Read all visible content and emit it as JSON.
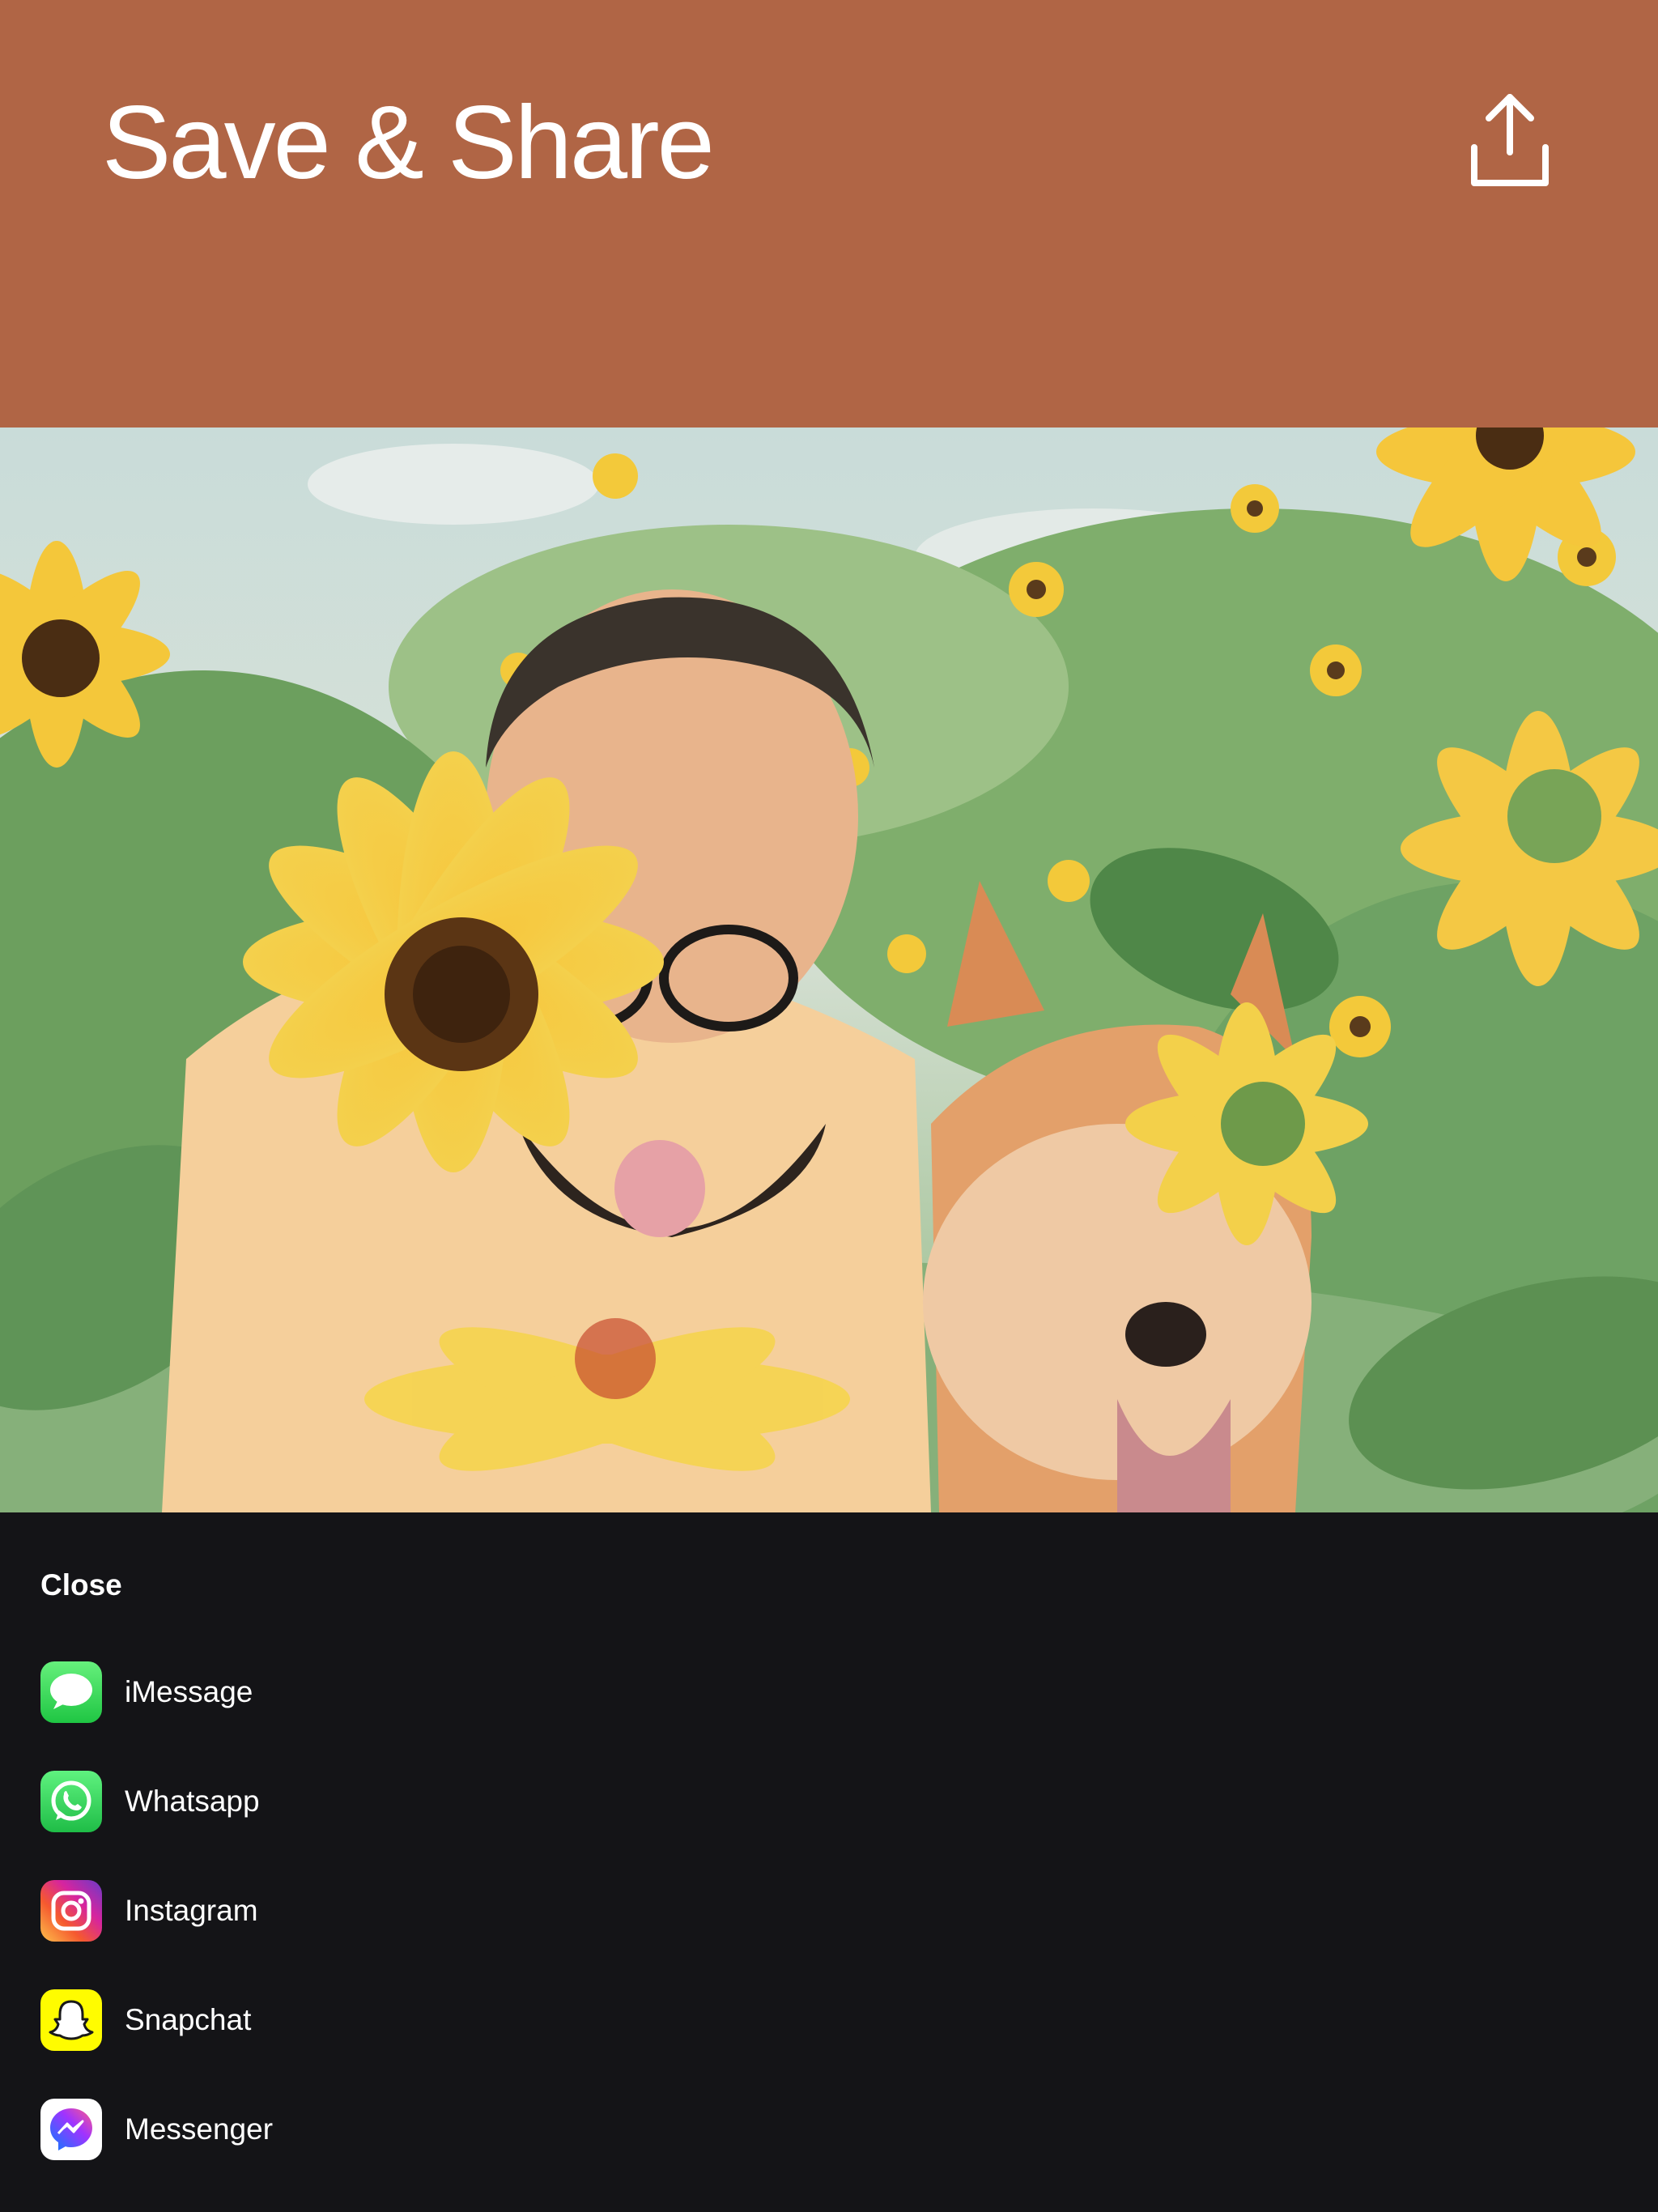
{
  "header": {
    "title": "Save & Share",
    "background": "#b06545",
    "share_icon": "share-upload-icon"
  },
  "photo": {
    "subject": "sunflower-field-man-and-dog"
  },
  "sheet": {
    "close_label": "Close",
    "background": "#141417",
    "apps": [
      {
        "label": "iMessage",
        "icon": "imessage-icon",
        "color": "#2fd158"
      },
      {
        "label": "Whatsapp",
        "icon": "whatsapp-icon",
        "color": "#25d366"
      },
      {
        "label": "Instagram",
        "icon": "instagram-icon",
        "color": "#d6249f"
      },
      {
        "label": "Snapchat",
        "icon": "snapchat-icon",
        "color": "#fffc00"
      },
      {
        "label": "Messenger",
        "icon": "messenger-icon",
        "color": "#0a7cff"
      }
    ]
  }
}
